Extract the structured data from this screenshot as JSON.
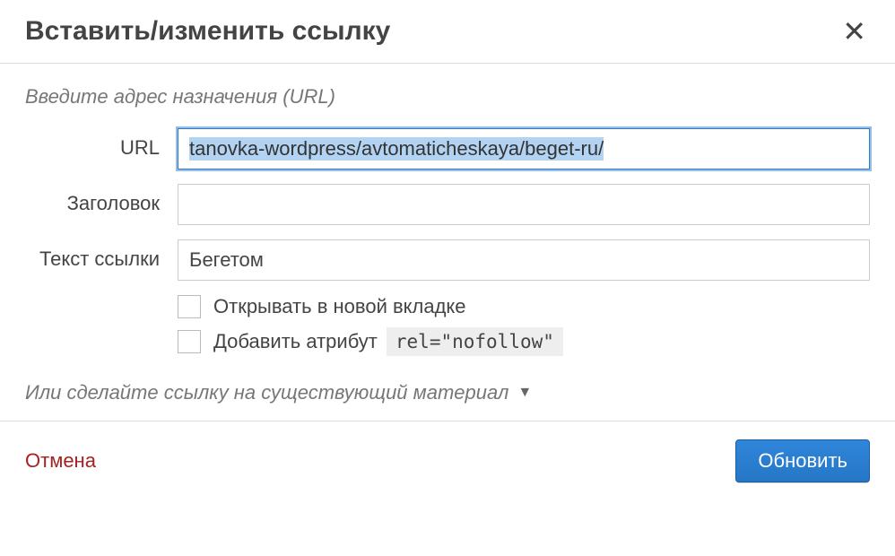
{
  "dialog": {
    "title": "Вставить/изменить ссылку",
    "close_label": "✕"
  },
  "form": {
    "section_label": "Введите адрес назначения (URL)",
    "url": {
      "label": "URL",
      "value": "tanovka-wordpress/avtomaticheskaya/beget-ru/"
    },
    "title_field": {
      "label": "Заголовок",
      "value": ""
    },
    "link_text": {
      "label": "Текст ссылки",
      "value": "Бегетом"
    },
    "new_tab": {
      "label": "Открывать в новой вкладке",
      "checked": false
    },
    "nofollow": {
      "label": "Добавить атрибут",
      "code": "rel=\"nofollow\"",
      "checked": false
    }
  },
  "existing": {
    "label": "Или сделайте ссылку на существующий материал",
    "triangle": "▼"
  },
  "footer": {
    "cancel": "Отмена",
    "submit": "Обновить"
  }
}
